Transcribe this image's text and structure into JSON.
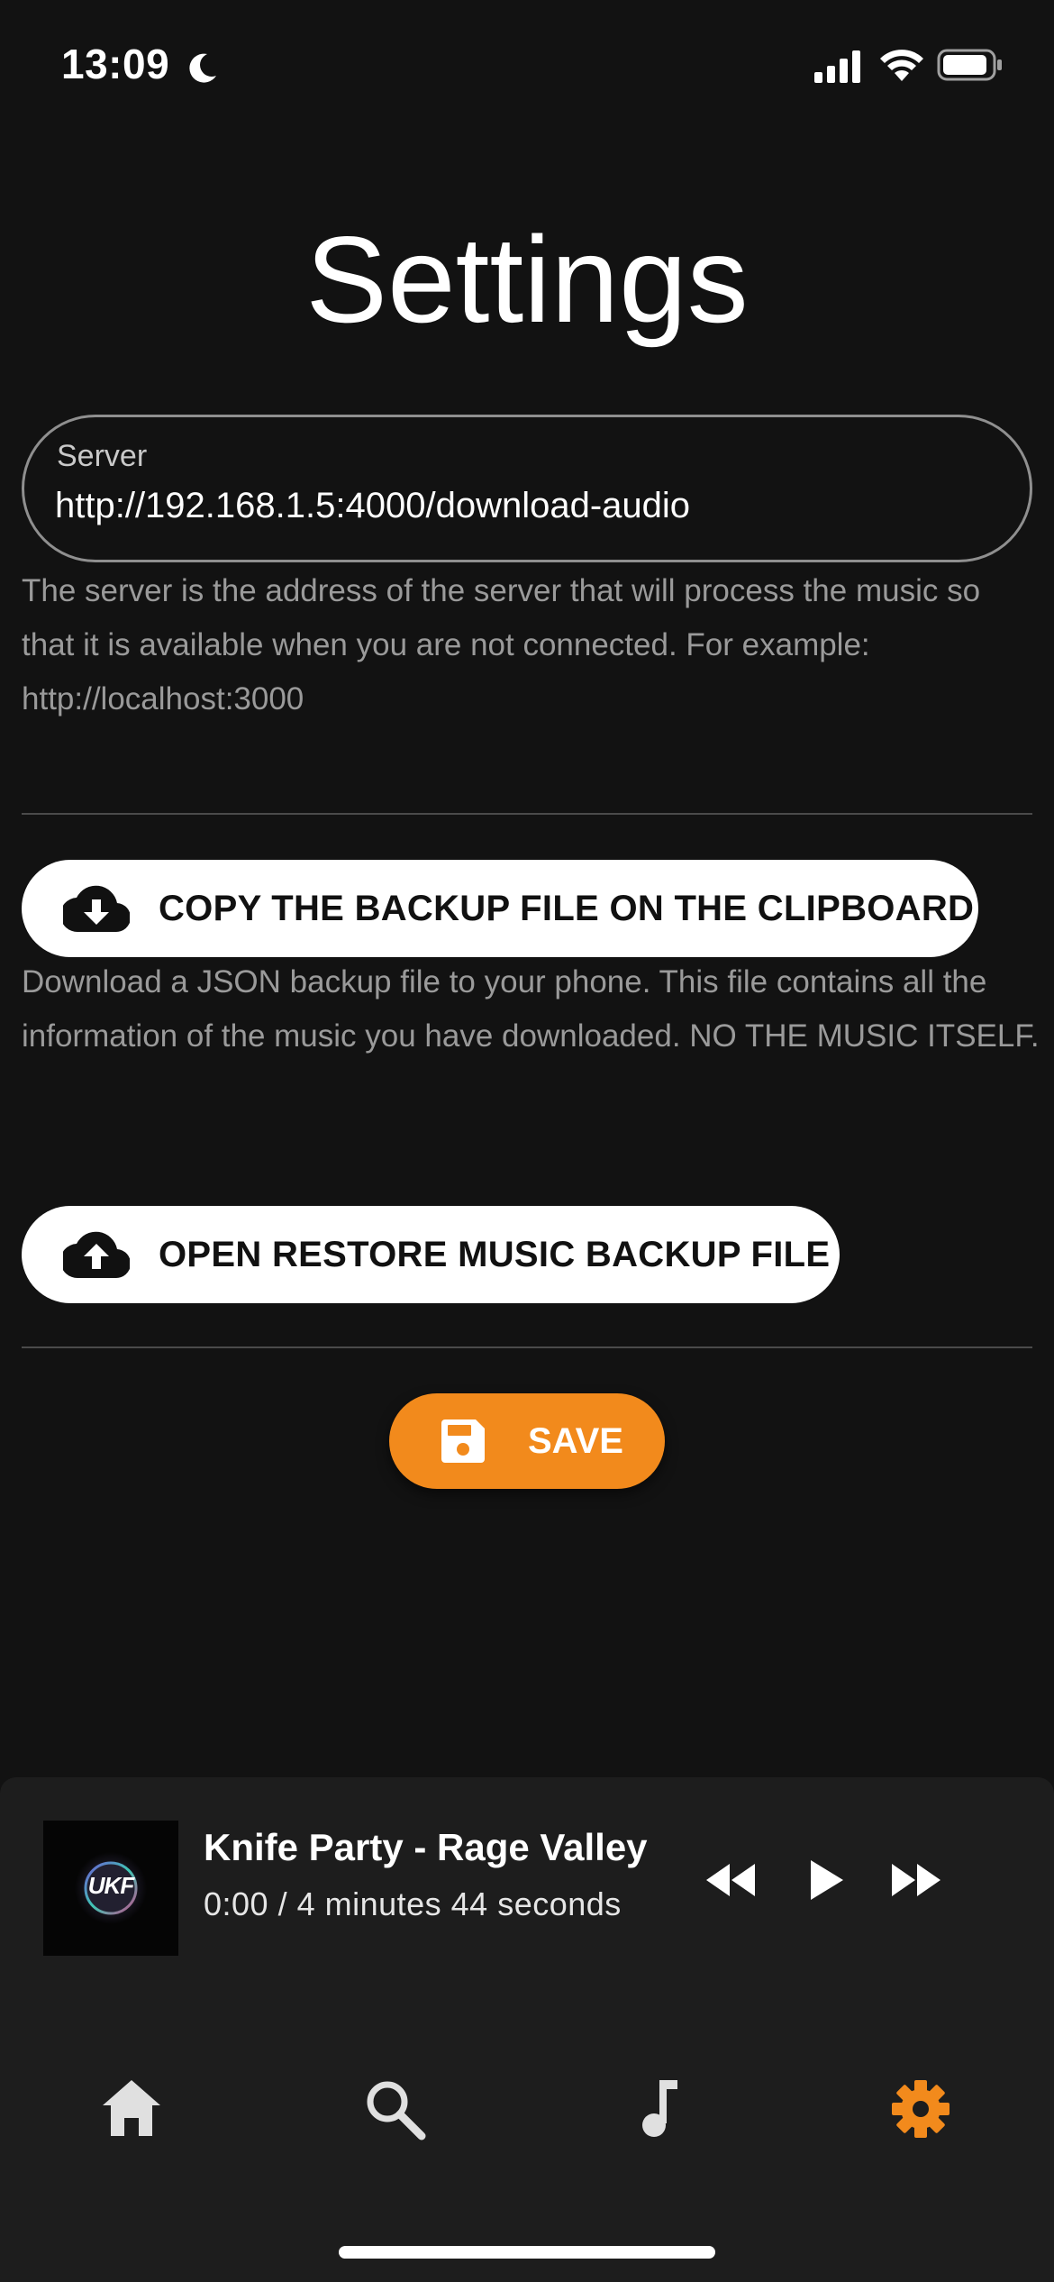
{
  "status_bar": {
    "time": "13:09"
  },
  "page": {
    "title": "Settings"
  },
  "server": {
    "label": "Server",
    "value": "http://192.168.1.5:4000/download-audio",
    "helper": "The server is the address of the server that will process the music so that it is available when you are not connected. For example: http://localhost:3000"
  },
  "backup": {
    "copy_label": "COPY THE BACKUP FILE ON THE CLIPBOARD",
    "copy_helper": "Download a JSON backup file to your phone. This file contains all the information of the music you have downloaded. NO THE MUSIC ITSELF.",
    "restore_label": "OPEN RESTORE MUSIC BACKUP FILE"
  },
  "save": {
    "label": "SAVE"
  },
  "player": {
    "track_title": "Knife Party - Rage Valley",
    "time_display": "0:00 / 4 minutes 44 seconds",
    "album_art_text": "UKF"
  },
  "nav": {
    "items": [
      {
        "icon": "home-icon",
        "active": false
      },
      {
        "icon": "search-icon",
        "active": false
      },
      {
        "icon": "music-note-icon",
        "active": false
      },
      {
        "icon": "gear-icon",
        "active": true
      }
    ]
  },
  "colors": {
    "background": "#121212",
    "accent": "#f28a1c",
    "player_background": "#1d1d1d",
    "helper_text": "#9a9a9a",
    "nav_inactive": "#e0e0e0"
  }
}
